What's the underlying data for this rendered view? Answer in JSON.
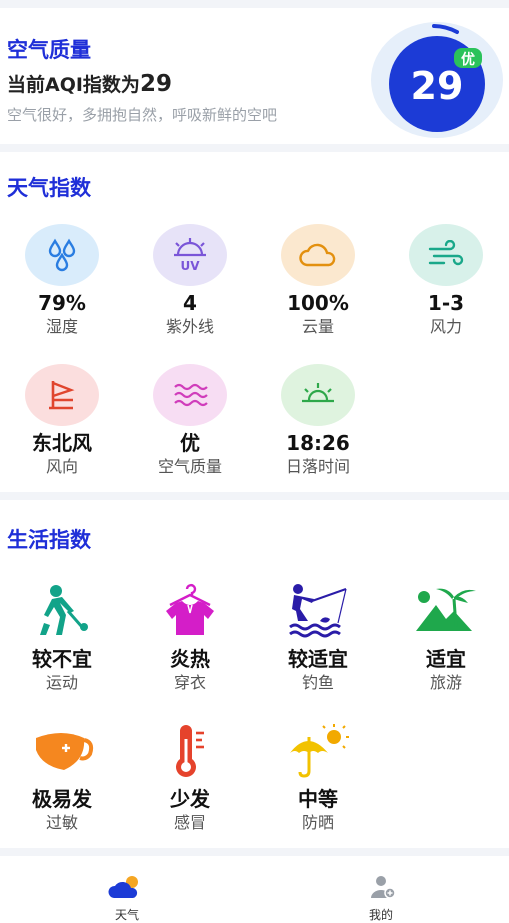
{
  "aqi": {
    "title": "空气质量",
    "line_prefix": "当前AQI指数为",
    "value": "29",
    "description": "空气很好，多拥抱自然，呼吸新鲜的空吧",
    "badge": "优",
    "ring_value": "29",
    "level_fraction": 0.06,
    "colors": {
      "circle": "#1c3bd6",
      "badge": "#2bc25a",
      "ring_bg": "#e6effa"
    }
  },
  "weather": {
    "title": "天气指数",
    "items": [
      {
        "icon": "water-drops-icon",
        "value": "79%",
        "label": "湿度",
        "color": "#d9ecfb"
      },
      {
        "icon": "uv-sun-icon",
        "value": "4",
        "label": "紫外线",
        "color": "#e7e3f8"
      },
      {
        "icon": "cloud-icon",
        "value": "100%",
        "label": "云量",
        "color": "#fbe8cf"
      },
      {
        "icon": "wind-icon",
        "value": "1-3",
        "label": "风力",
        "color": "#d8f1ea"
      },
      {
        "icon": "wind-flag-icon",
        "value": "东北风",
        "label": "风向",
        "color": "#fbdede"
      },
      {
        "icon": "waves-icon",
        "value": "优",
        "label": "空气质量",
        "color": "#f7ddf3"
      },
      {
        "icon": "sunset-icon",
        "value": "18:26",
        "label": "日落时间",
        "color": "#dff3df"
      }
    ]
  },
  "life": {
    "title": "生活指数",
    "items": [
      {
        "icon": "golf-player-icon",
        "value": "较不宜",
        "label": "运动"
      },
      {
        "icon": "tshirt-hanger-icon",
        "value": "炎热",
        "label": "穿衣"
      },
      {
        "icon": "fishing-icon",
        "value": "较适宜",
        "label": "钓鱼"
      },
      {
        "icon": "island-palm-icon",
        "value": "适宜",
        "label": "旅游"
      },
      {
        "icon": "mask-icon",
        "value": "极易发",
        "label": "过敏"
      },
      {
        "icon": "thermometer-icon",
        "value": "少发",
        "label": "感冒"
      },
      {
        "icon": "umbrella-sun-icon",
        "value": "中等",
        "label": "防晒"
      }
    ]
  },
  "tabbar": {
    "tabs": [
      {
        "icon": "weather-cloud-icon",
        "label": "天气"
      },
      {
        "icon": "user-profile-icon",
        "label": "我的"
      }
    ]
  }
}
